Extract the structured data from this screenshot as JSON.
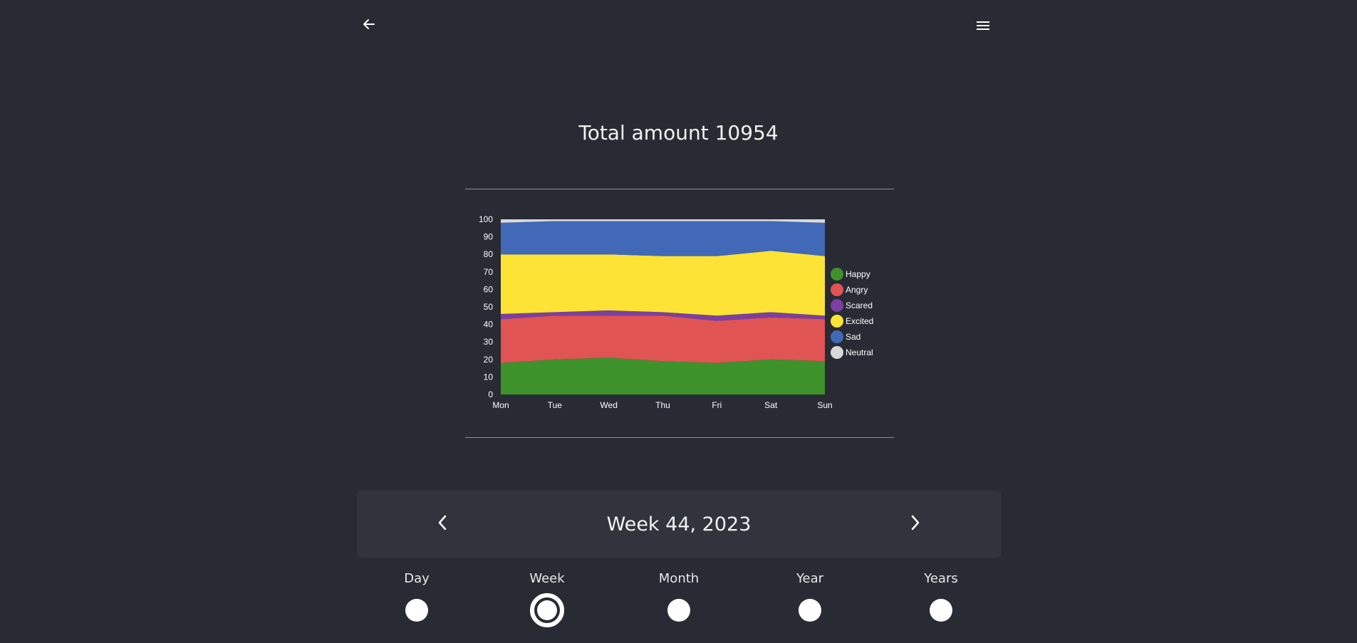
{
  "header": {
    "back_icon": "arrow-left-icon",
    "menu_icon": "hamburger-menu-icon"
  },
  "summary": {
    "title": "Total amount 10954"
  },
  "chart_data": {
    "type": "area",
    "stacked": true,
    "categories": [
      "Mon",
      "Tue",
      "Wed",
      "Thu",
      "Fri",
      "Sat",
      "Sun"
    ],
    "ylim": [
      0,
      100
    ],
    "yticks": [
      0,
      10,
      20,
      30,
      40,
      50,
      60,
      70,
      80,
      90,
      100
    ],
    "legend_position": "right",
    "series": [
      {
        "name": "Happy",
        "color": "#3e922b",
        "values": [
          18,
          20,
          21,
          19,
          18,
          20,
          19
        ]
      },
      {
        "name": "Angry",
        "color": "#e05454",
        "values": [
          25,
          25,
          24,
          26,
          24,
          24,
          24
        ]
      },
      {
        "name": "Scared",
        "color": "#7b3fa0",
        "values": [
          3,
          2,
          3,
          2,
          3,
          3,
          2
        ]
      },
      {
        "name": "Excited",
        "color": "#fce335",
        "values": [
          34,
          33,
          32,
          32,
          34,
          35,
          34
        ]
      },
      {
        "name": "Sad",
        "color": "#4169b8",
        "values": [
          18,
          19,
          19,
          20,
          20,
          17,
          19
        ]
      },
      {
        "name": "Neutral",
        "color": "#d9d9d9",
        "values": [
          2,
          1,
          1,
          1,
          1,
          1,
          2
        ]
      }
    ]
  },
  "navigator": {
    "period_label": "Week 44, 2023",
    "prev_icon": "chevron-left-icon",
    "next_icon": "chevron-right-icon"
  },
  "range": {
    "selected": "Week",
    "options": [
      "Day",
      "Week",
      "Month",
      "Year",
      "Years"
    ]
  }
}
